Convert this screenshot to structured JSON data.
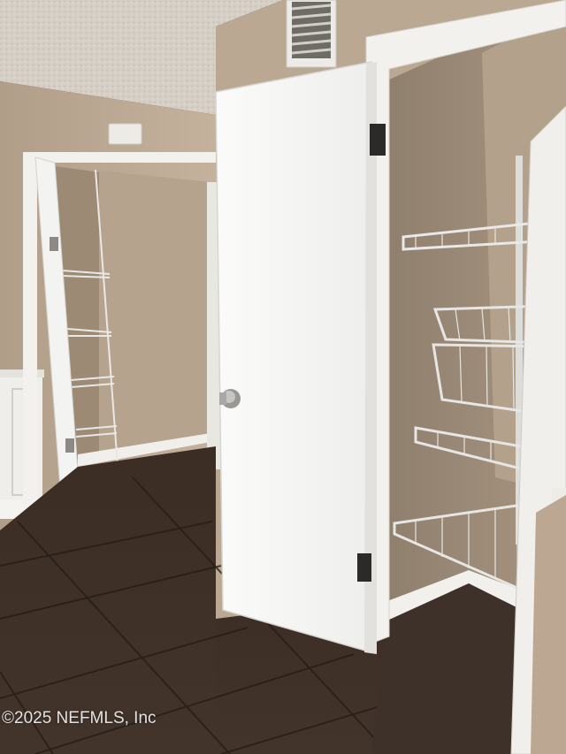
{
  "photo": {
    "watermark": "©2025 NEFMLS, Inc"
  },
  "colors": {
    "wall": "#b8a58f",
    "wall_shadow": "#9f8d78",
    "ceiling": "#d9d2c8",
    "door": "#f4f4f2",
    "trim": "#f1f0ec",
    "floor": "#3d3028",
    "floor_grout": "#2a211b",
    "shelf": "#e6e6e4"
  }
}
